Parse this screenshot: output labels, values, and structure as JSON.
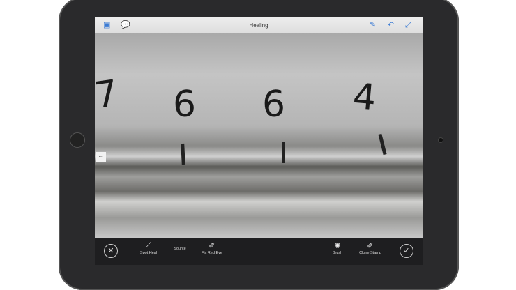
{
  "header": {
    "title": "Healing",
    "left_icons": [
      "photo-icon",
      "comments-icon"
    ],
    "right_icons": [
      "pencil-icon",
      "undo-icon",
      "fullscreen-icon"
    ]
  },
  "photo": {
    "digits": [
      "7",
      "6",
      "6",
      "4"
    ]
  },
  "side_handle": "...",
  "toolbar": {
    "cancel": "cancel-icon",
    "spot_heal": "Spot Heal",
    "source": "Source",
    "fix_red_eye": "Fix Red Eye",
    "brush": "Brush",
    "clone_stamp": "Clone Stamp",
    "confirm": "check-icon"
  }
}
